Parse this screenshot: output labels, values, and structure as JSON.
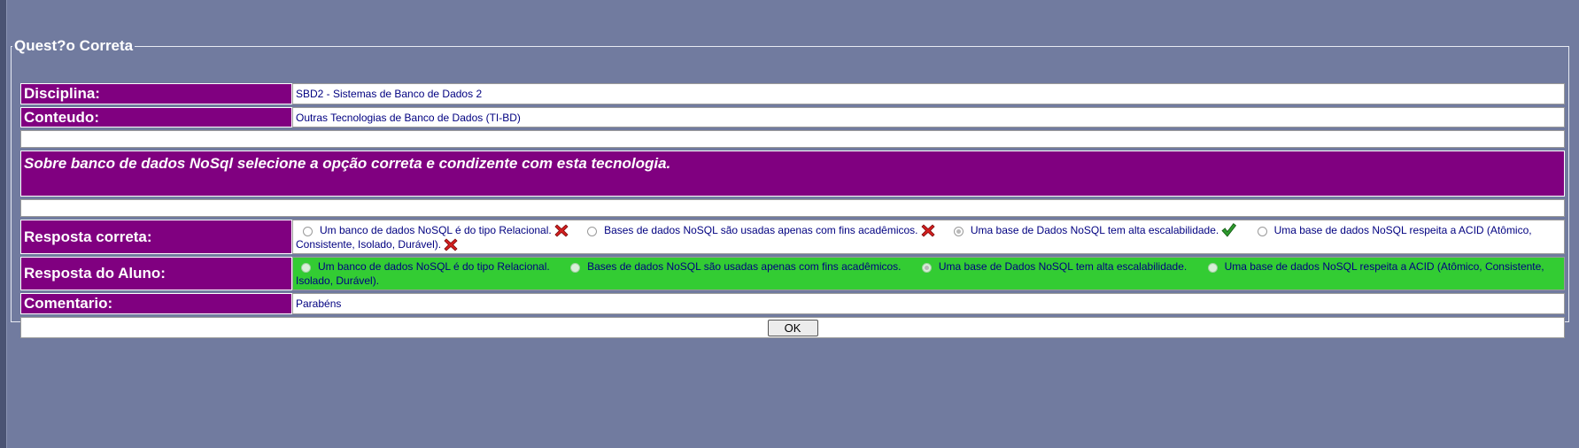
{
  "form": {
    "legend": "Quest?o Correta",
    "disciplina_label": "Disciplina:",
    "disciplina_value": "SBD2 - Sistemas de Banco de Dados 2",
    "conteudo_label": "Conteudo:",
    "conteudo_value": "Outras Tecnologias de Banco de Dados (TI-BD)",
    "question": "Sobre banco de dados NoSql selecione a opção correta e condizente com esta tecnologia.",
    "resposta_correta_label": "Resposta correta:",
    "resposta_aluno_label": "Resposta do Aluno:",
    "comentario_label": "Comentario:",
    "comentario_value": "Parabéns",
    "ok_label": "OK"
  },
  "options": [
    {
      "text": "Um banco de dados NoSQL é do tipo Relacional.",
      "correct": false
    },
    {
      "text": "Bases de dados NoSQL são usadas apenas com fins acadêmicos.",
      "correct": false
    },
    {
      "text": "Uma base de Dados NoSQL tem alta escalabilidade.",
      "correct": true
    },
    {
      "text": "Uma base de dados NoSQL respeita a ACID (Atômico, Consistente, Isolado, Durável).",
      "correct": false
    }
  ],
  "colors": {
    "label_bg": "#800080",
    "student_bg": "#33cc33",
    "page_bg": "#717b9f"
  }
}
